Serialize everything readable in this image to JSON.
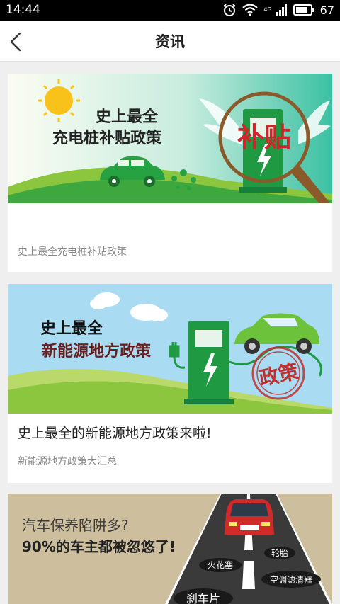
{
  "status_bar": {
    "time": "14:44",
    "network": "4G",
    "battery": "67"
  },
  "app_bar": {
    "title": "资讯"
  },
  "colors": {
    "green": "#2aa44a",
    "teal": "#3ec3a4",
    "sky": "#a8d9f0",
    "red": "#d0262b",
    "road": "#3a3a3a"
  },
  "articles": [
    {
      "banner": {
        "line1": "史上最全",
        "line2": "充电桩补贴政策",
        "stamp": "补贴"
      },
      "headline": "",
      "summary": "史上最全充电桩补贴政策"
    },
    {
      "banner": {
        "line1": "史上最全",
        "line2": "新能源地方政策",
        "stamp": "政策"
      },
      "headline": "史上最全的新能源地方政策来啦!",
      "summary": "新能源地方政策大汇总"
    },
    {
      "banner": {
        "line1": "汽车保养陷阱多?",
        "line2": "90%的车主都被忽悠了!",
        "labels": [
          "轮胎",
          "火花塞",
          "空调滤清器",
          "刹车片"
        ]
      }
    }
  ]
}
